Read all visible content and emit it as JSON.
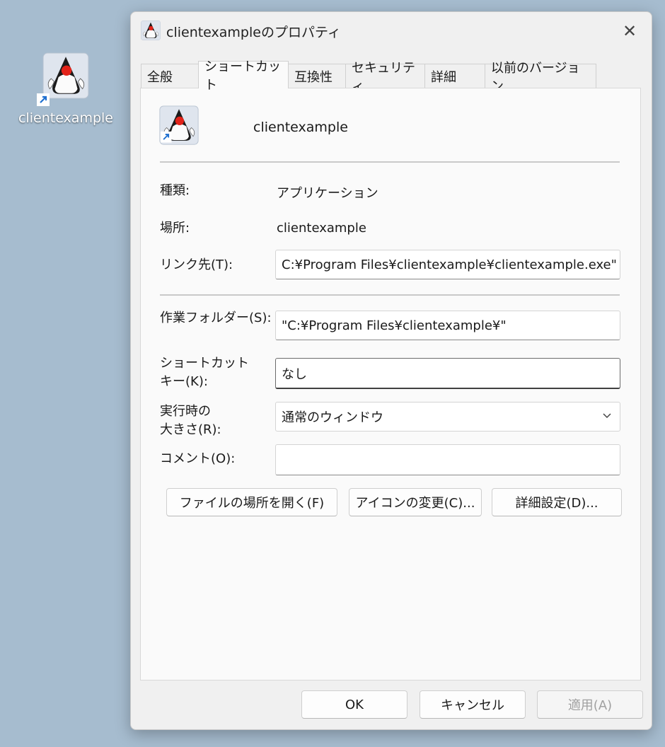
{
  "desktop": {
    "icon_label": "clientexample"
  },
  "dialog": {
    "title": "clientexampleのプロパティ",
    "close_glyph": "✕",
    "tabs": [
      "全般",
      "ショートカット",
      "互換性",
      "セキュリティ",
      "詳細",
      "以前のバージョン"
    ],
    "active_tab": "ショートカット",
    "header_name": "clientexample",
    "rows": {
      "type_label": "種類:",
      "type_value": "アプリケーション",
      "location_label": "場所:",
      "location_value": "clientexample",
      "target_label": "リンク先(T):",
      "target_value": "C:¥Program Files¥clientexample¥clientexample.exe\"",
      "workdir_label": "作業フォルダー(S):",
      "workdir_value": "\"C:¥Program Files¥clientexample¥\"",
      "hotkey_label_line1": "ショートカット",
      "hotkey_label_line2": "キー(K):",
      "hotkey_value": "なし",
      "run_label_line1": "実行時の",
      "run_label_line2": "大きさ(R):",
      "run_value": "通常のウィンドウ",
      "comment_label": "コメント(O):",
      "comment_value": ""
    },
    "buttons": {
      "open_location": "ファイルの場所を開く(F)",
      "change_icon": "アイコンの変更(C)...",
      "advanced": "詳細設定(D)...",
      "ok": "OK",
      "cancel": "キャンセル",
      "apply": "適用(A)"
    }
  }
}
